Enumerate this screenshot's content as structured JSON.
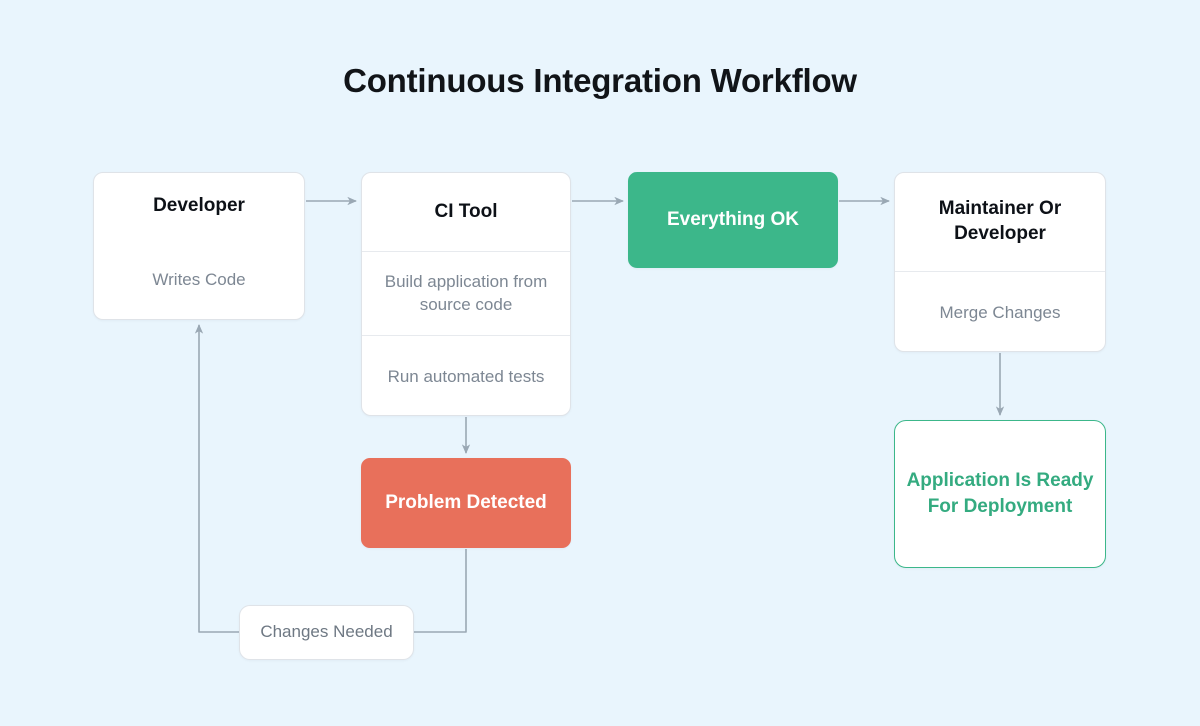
{
  "page": {
    "title": "Continuous Integration Workflow",
    "background_color": "#e9f5fd"
  },
  "colors": {
    "accent_green": "#3cb78a",
    "accent_green_text": "#34ab80",
    "accent_red": "#e8705b",
    "node_border": "#dfe3e8",
    "node_background": "#ffffff",
    "title_text": "#111418",
    "muted_text": "#7d8793",
    "connector": "#9aa8b4"
  },
  "nodes": {
    "developer": {
      "title": "Developer",
      "rows": [
        "Writes Code"
      ]
    },
    "ci_tool": {
      "title": "CI Tool",
      "rows": [
        "Build application from source code",
        "Run automated tests"
      ]
    },
    "everything_ok": {
      "title": "Everything OK"
    },
    "maintainer": {
      "title": "Maintainer Or Developer",
      "rows": [
        "Merge Changes"
      ]
    },
    "problem_detected": {
      "title": "Problem Detected"
    },
    "ready_for_deployment": {
      "title": "Application Is Ready For Deployment"
    },
    "changes_needed": {
      "label": "Changes Needed"
    }
  },
  "connectors": [
    {
      "name": "developer-to-ci-tool",
      "from": "developer",
      "to": "ci_tool",
      "direction": "right"
    },
    {
      "name": "ci-tool-to-everything-ok",
      "from": "ci_tool",
      "to": "everything_ok",
      "direction": "right"
    },
    {
      "name": "everything-ok-to-maintainer",
      "from": "everything_ok",
      "to": "maintainer",
      "direction": "right"
    },
    {
      "name": "ci-tool-to-problem-detected",
      "from": "ci_tool",
      "to": "problem_detected",
      "direction": "down"
    },
    {
      "name": "maintainer-to-ready",
      "from": "maintainer",
      "to": "ready_for_deployment",
      "direction": "down"
    },
    {
      "name": "problem-detected-to-developer",
      "from": "problem_detected",
      "to": "developer",
      "direction": "up",
      "label": "Changes Needed"
    }
  ]
}
